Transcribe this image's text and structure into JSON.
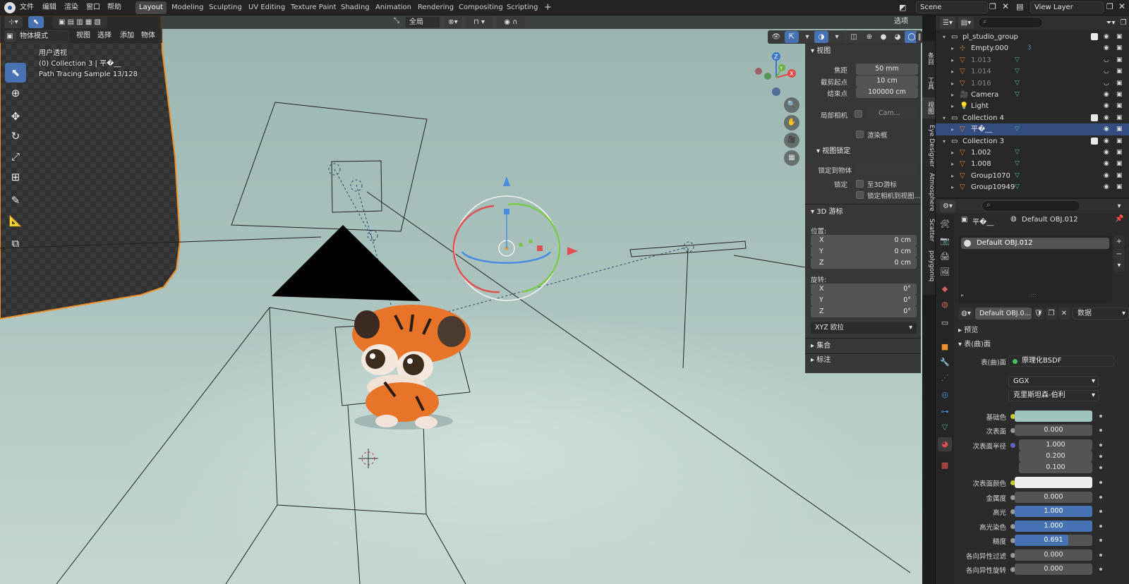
{
  "topbar": {
    "menus": [
      "文件",
      "编辑",
      "渲染",
      "窗口",
      "帮助"
    ],
    "workspaces": [
      "Layout",
      "Modeling",
      "Sculpting",
      "UV Editing",
      "Texture Paint",
      "Shading",
      "Animation",
      "Rendering",
      "Compositing",
      "Scripting"
    ],
    "active_workspace": "Layout",
    "add_tab": "+",
    "scene": "Scene",
    "view_layer": "View Layer"
  },
  "viewport": {
    "mode": "物体模式",
    "menus": [
      "视图",
      "选择",
      "添加",
      "物体"
    ],
    "transform_orientation": "全局",
    "options_label": "选项",
    "overlay_lines": [
      "用户透视",
      "(0) Collection 3 | 平�__",
      "Path Tracing Sample 13/128"
    ],
    "gizmo_axes": [
      "X",
      "Y",
      "Z"
    ]
  },
  "npanel": {
    "view_header": "视图",
    "focal_label": "焦距",
    "focal_value": "50 mm",
    "clip_start_label": "截剪起点",
    "clip_start_value": "10 cm",
    "clip_end_label": "结束点",
    "clip_end_value": "100000 cm",
    "local_camera_label": "局部相机",
    "local_camera_value": "Cam...",
    "render_region_label": "渲染框",
    "view_lock_header": "视图锁定",
    "lock_to_object_label": "锁定到物体",
    "lock_label": "锁定",
    "lock_3d_cursor": "至3D游标",
    "lock_camera_view": "锁定相机到视图...",
    "cursor_header": "3D 游标",
    "location_label": "位置:",
    "location": [
      {
        "axis": "X",
        "value": "0 cm"
      },
      {
        "axis": "Y",
        "value": "0 cm"
      },
      {
        "axis": "Z",
        "value": "0 cm"
      }
    ],
    "rotation_label": "旋转:",
    "rotation": [
      {
        "axis": "X",
        "value": "0°"
      },
      {
        "axis": "Y",
        "value": "0°"
      },
      {
        "axis": "Z",
        "value": "0°"
      }
    ],
    "rotation_mode": "XYZ 欧拉",
    "collection_header": "集合",
    "annotation_header": "标注"
  },
  "side_tabs": [
    "条目",
    "工具",
    "视图",
    "Eye Designer",
    "Atmosphere",
    "Scatter",
    "polygoniq"
  ],
  "outliner": {
    "rows": [
      {
        "name": "pl_studio_group",
        "indent": 1,
        "icon": "collection-icon",
        "selected": false,
        "dim": false,
        "badge": ""
      },
      {
        "name": "Empty.000",
        "indent": 2,
        "icon": "empty-icon",
        "selected": false,
        "dim": false,
        "badge": "3"
      },
      {
        "name": "1.013",
        "indent": 2,
        "icon": "mesh-icon",
        "selected": false,
        "dim": true,
        "badge": ""
      },
      {
        "name": "1.014",
        "indent": 2,
        "icon": "mesh-icon",
        "selected": false,
        "dim": true,
        "badge": ""
      },
      {
        "name": "1.016",
        "indent": 2,
        "icon": "mesh-icon",
        "selected": false,
        "dim": true,
        "badge": ""
      },
      {
        "name": "Camera",
        "indent": 2,
        "icon": "camera-icon",
        "selected": false,
        "dim": false,
        "badge": ""
      },
      {
        "name": "Light",
        "indent": 2,
        "icon": "light-icon",
        "selected": false,
        "dim": false,
        "badge": ""
      },
      {
        "name": "Collection 4",
        "indent": 1,
        "icon": "collection-icon",
        "selected": false,
        "dim": false,
        "badge": ""
      },
      {
        "name": "平�__",
        "indent": 2,
        "icon": "mesh-icon",
        "selected": true,
        "dim": false,
        "badge": ""
      },
      {
        "name": "Collection 3",
        "indent": 1,
        "icon": "collection-icon",
        "selected": false,
        "dim": false,
        "badge": ""
      },
      {
        "name": "1.002",
        "indent": 2,
        "icon": "mesh-icon",
        "selected": false,
        "dim": false,
        "badge": ""
      },
      {
        "name": "1.008",
        "indent": 2,
        "icon": "mesh-icon",
        "selected": false,
        "dim": false,
        "badge": ""
      },
      {
        "name": "Group1070",
        "indent": 2,
        "icon": "mesh-icon",
        "selected": false,
        "dim": false,
        "badge": ""
      },
      {
        "name": "Group10949",
        "indent": 2,
        "icon": "mesh-icon",
        "selected": false,
        "dim": false,
        "badge": ""
      }
    ]
  },
  "properties": {
    "object_name": "平�__",
    "material_name": "Default OBJ.012",
    "slot_name": "Default OBJ.012",
    "material_field": "Default OBJ.0...",
    "data_label": "数据",
    "preview_header": "预览",
    "surface_header": "表(曲)面",
    "surface_label": "表(曲)面",
    "surface_value": "原理化BSDF",
    "distribution": "GGX",
    "subsurface_method": "克里斯坦森-伯利",
    "rows": [
      {
        "label": "基础色",
        "value": "",
        "kind": "color",
        "color": "#9dc4bd",
        "dot": "#c8c832"
      },
      {
        "label": "次表面",
        "value": "0.000",
        "kind": "num",
        "dot": "#999999"
      },
      {
        "label": "次表面半径",
        "value": "1.000",
        "kind": "num",
        "dot": "#6363c7"
      },
      {
        "label": "",
        "value": "0.200",
        "kind": "num",
        "dot": ""
      },
      {
        "label": "",
        "value": "0.100",
        "kind": "num",
        "dot": ""
      },
      {
        "label": "次表面颜色",
        "value": "",
        "kind": "color",
        "color": "#ececec",
        "dot": "#c8c832"
      },
      {
        "label": "金属度",
        "value": "0.000",
        "kind": "num",
        "dot": "#999999"
      },
      {
        "label": "高光",
        "value": "1.000",
        "kind": "bar",
        "fill": 1.0,
        "dot": "#999999"
      },
      {
        "label": "高光染色",
        "value": "1.000",
        "kind": "bar",
        "fill": 1.0,
        "dot": "#999999"
      },
      {
        "label": "糙度",
        "value": "0.691",
        "kind": "bar",
        "fill": 0.691,
        "dot": "#999999"
      },
      {
        "label": "各向异性过滤",
        "value": "0.000",
        "kind": "num",
        "dot": "#999999"
      },
      {
        "label": "各向异性旋转",
        "value": "0.000",
        "kind": "num",
        "dot": "#999999"
      }
    ]
  },
  "colors": {
    "accent": "#4772b3",
    "selected_row": "#334d80",
    "orange_select": "#f0902a"
  }
}
